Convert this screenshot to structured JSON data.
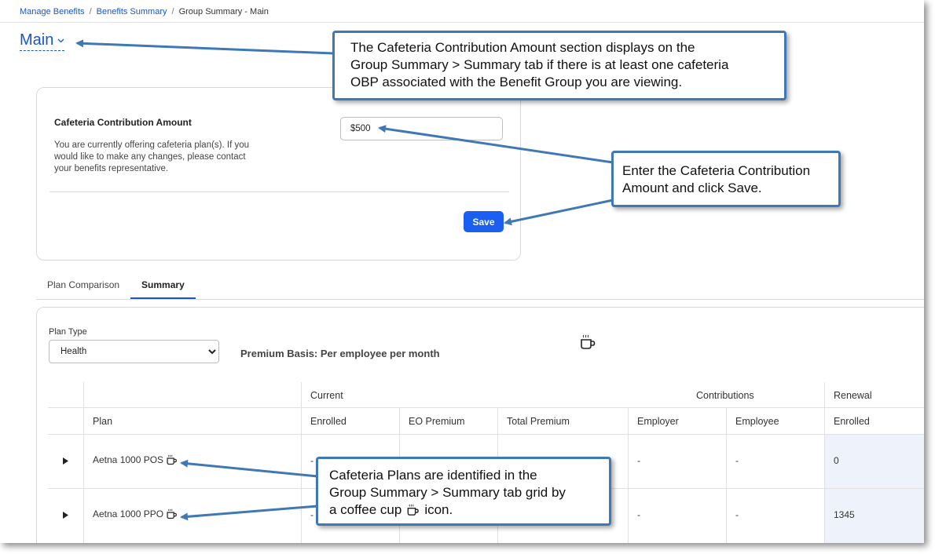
{
  "breadcrumb": {
    "items": [
      "Manage Benefits",
      "Benefits Summary"
    ],
    "separator": "/",
    "current": "Group Summary - Main"
  },
  "page_title": "Main",
  "cafeteria": {
    "title": "Cafeteria Contribution Amount",
    "description": "You are currently offering cafeteria plan(s). If you would like to make any changes, please contact your benefits representative.",
    "amount_value": "$500",
    "save_label": "Save"
  },
  "tabs": [
    {
      "label": "Plan Comparison",
      "active": false
    },
    {
      "label": "Summary",
      "active": true
    }
  ],
  "summary": {
    "plan_type_label": "Plan Type",
    "plan_type_selected": "Health",
    "premium_basis": "Premium Basis: Per employee per month",
    "group_headers": {
      "current": "Current",
      "contributions": "Contributions",
      "renewal": "Renewal"
    },
    "columns": [
      "Plan",
      "Enrolled",
      "EO Premium",
      "Total Premium",
      "Employer",
      "Employee",
      "Enrolled"
    ],
    "rows": [
      {
        "plan": "Aetna 1000 POS",
        "enrolled": "-",
        "employer": "-",
        "employee": "-",
        "renewal_enrolled": "0"
      },
      {
        "plan": "Aetna 1000 PPO",
        "enrolled": "-",
        "employer": "-",
        "employee": "-",
        "renewal_enrolled": "1345"
      }
    ]
  },
  "callouts": {
    "c1_lines": [
      "The Cafeteria Contribution Amount section displays on the",
      "Group Summary > Summary tab if there is at least one cafeteria",
      "OBP associated with the Benefit Group you are viewing."
    ],
    "c2_lines": [
      "Enter the Cafeteria Contribution",
      "Amount and click Save."
    ],
    "c3_lines": [
      "Cafeteria Plans are identified in the",
      "Group Summary > Summary tab grid by"
    ],
    "c3_last_prefix": "a coffee cup",
    "c3_last_suffix": "icon."
  },
  "colors": {
    "accent": "#1a56c8",
    "button": "#1a5ff0",
    "callout_border": "#3f78b4",
    "renewal_bg": "#eef2fb"
  }
}
